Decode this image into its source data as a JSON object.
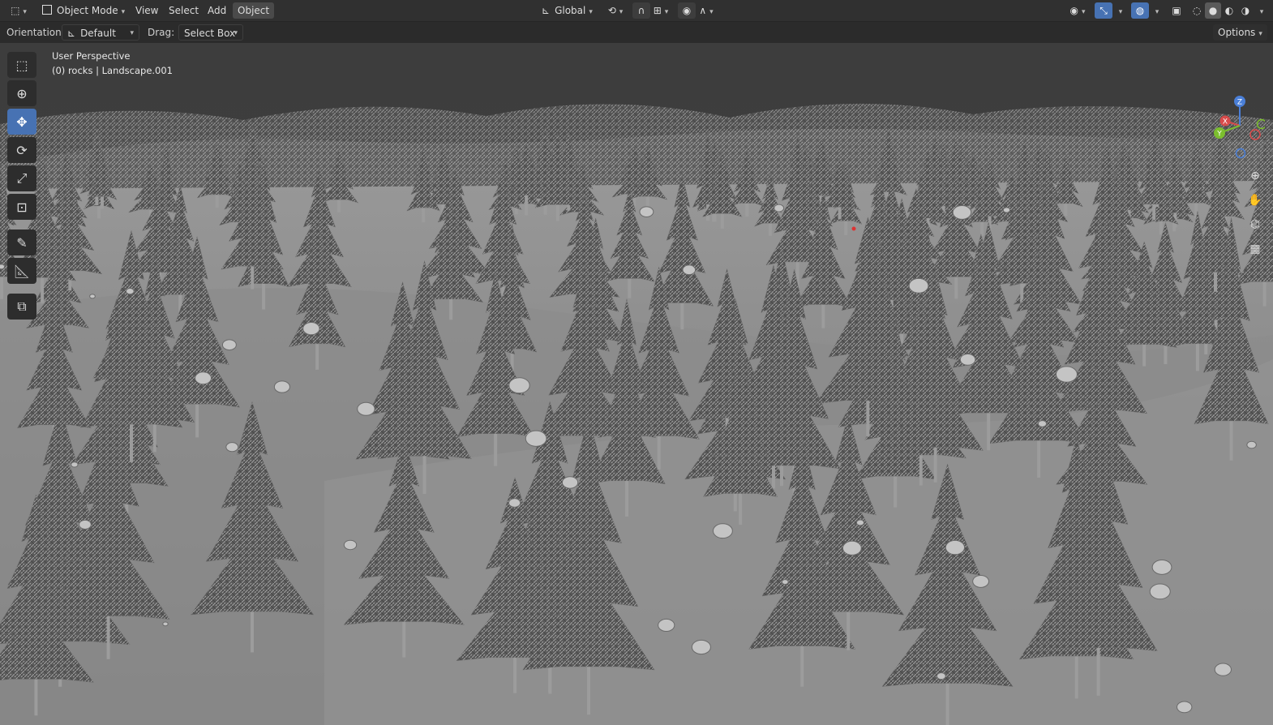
{
  "header": {
    "editor_icon": "editor-type-icon",
    "mode": "Object Mode",
    "menus": [
      "View",
      "Select",
      "Add",
      "Object"
    ],
    "active_menu": "Object",
    "transform_orientation": "Global"
  },
  "tool_settings": {
    "orientation_label": "Orientation:",
    "orientation_value": "Default",
    "drag_label": "Drag:",
    "drag_value": "Select Box",
    "options_label": "Options"
  },
  "viewport": {
    "view_name": "User Perspective",
    "object_info": "(0) rocks | Landscape.001"
  },
  "gizmo": {
    "x": "X",
    "y": "Y",
    "z": "Z"
  },
  "toolbar": {
    "tools": [
      "select-box",
      "cursor",
      "move",
      "rotate",
      "scale",
      "transform",
      "annotate",
      "measure",
      "add-cube"
    ],
    "active": "move"
  },
  "colors": {
    "accent": "#4772b3",
    "x_axis": "#d84b4b",
    "y_axis": "#7cbf2e",
    "z_axis": "#4a7fd8",
    "header_bg": "#303030"
  }
}
